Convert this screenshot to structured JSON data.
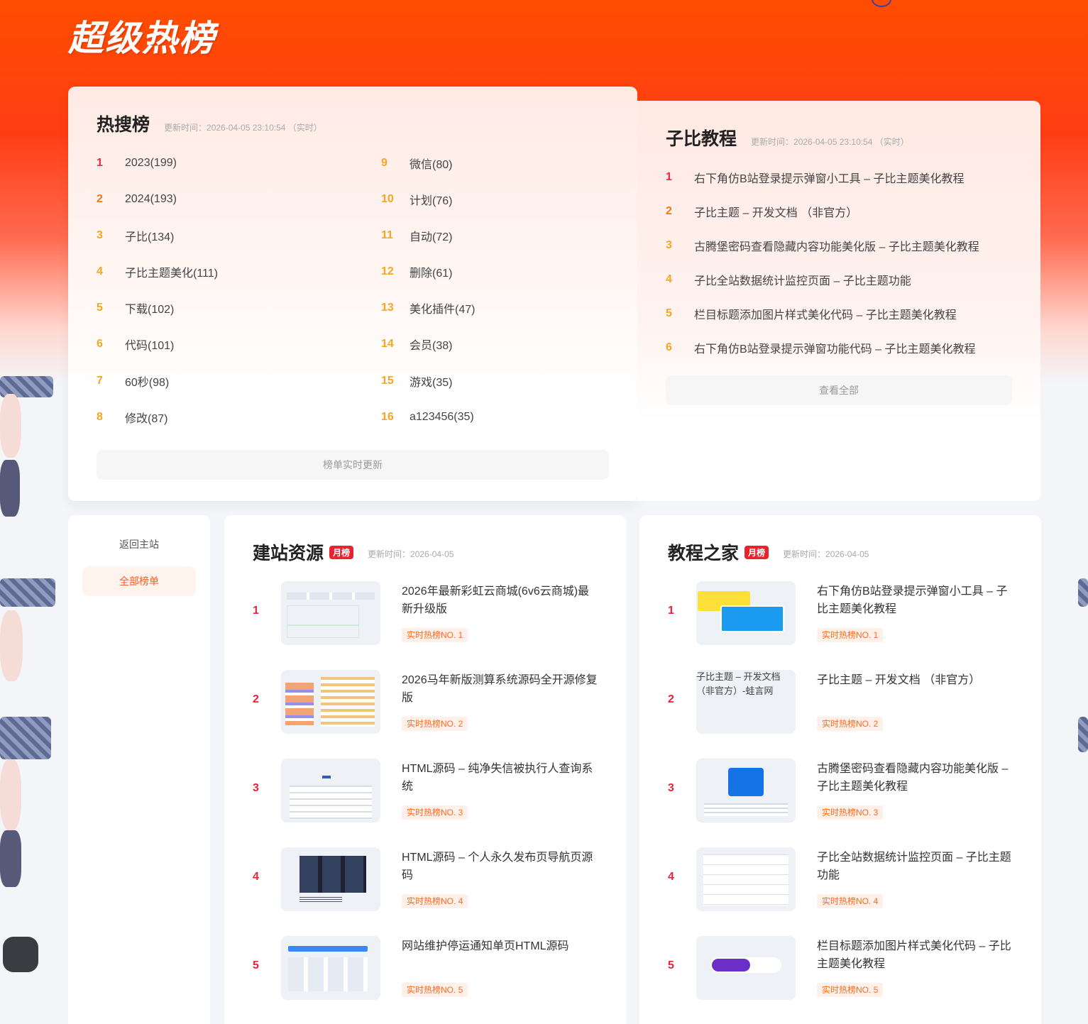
{
  "page": {
    "title": "超级热榜"
  },
  "hot_search": {
    "title": "热搜榜",
    "meta": "更新时间：2026-04-05 23:10:54 （实时）",
    "footer": "榜单实时更新",
    "items": [
      {
        "rank": "1",
        "label": "2023(199)"
      },
      {
        "rank": "2",
        "label": "2024(193)"
      },
      {
        "rank": "3",
        "label": "子比(134)"
      },
      {
        "rank": "4",
        "label": "子比主题美化(111)"
      },
      {
        "rank": "5",
        "label": "下载(102)"
      },
      {
        "rank": "6",
        "label": "代码(101)"
      },
      {
        "rank": "7",
        "label": "60秒(98)"
      },
      {
        "rank": "8",
        "label": "修改(87)"
      },
      {
        "rank": "9",
        "label": "微信(80)"
      },
      {
        "rank": "10",
        "label": "计划(76)"
      },
      {
        "rank": "11",
        "label": "自动(72)"
      },
      {
        "rank": "12",
        "label": "删除(61)"
      },
      {
        "rank": "13",
        "label": "美化插件(47)"
      },
      {
        "rank": "14",
        "label": "会员(38)"
      },
      {
        "rank": "15",
        "label": "游戏(35)"
      },
      {
        "rank": "16",
        "label": "a123456(35)"
      }
    ]
  },
  "zibi_tutorial": {
    "title": "子比教程",
    "meta": "更新时间：2026-04-05 23:10:54 （实时）",
    "footer": "查看全部",
    "items": [
      {
        "rank": "1",
        "label": "右下角仿B站登录提示弹窗小工具 – 子比主题美化教程"
      },
      {
        "rank": "2",
        "label": "子比主题 – 开发文档 （非官方）"
      },
      {
        "rank": "3",
        "label": "古腾堡密码查看隐藏内容功能美化版 – 子比主题美化教程"
      },
      {
        "rank": "4",
        "label": "子比全站数据统计监控页面 – 子比主题功能"
      },
      {
        "rank": "5",
        "label": "栏目标题添加图片样式美化代码 – 子比主题美化教程"
      },
      {
        "rank": "6",
        "label": "右下角仿B站登录提示弹窗功能代码 – 子比主题美化教程"
      }
    ]
  },
  "side_nav": {
    "home": "返回主站",
    "all": "全部榜单"
  },
  "site_resources": {
    "title": "建站资源",
    "tag": "月榜",
    "meta": "更新时间：2026-04-05",
    "items": [
      {
        "rank": "1",
        "title": "2026年最新彩虹云商城(6v6云商城)最新升级版",
        "badge": "实时热榜NO. 1"
      },
      {
        "rank": "2",
        "title": "2026马年新版测算系统源码全开源修复版",
        "badge": "实时热榜NO. 2"
      },
      {
        "rank": "3",
        "title": "HTML源码 – 纯净失信被执行人查询系统",
        "badge": "实时热榜NO. 3"
      },
      {
        "rank": "4",
        "title": "HTML源码 – 个人永久发布页导航页源码",
        "badge": "实时热榜NO. 4"
      },
      {
        "rank": "5",
        "title": "网站维护停运通知单页HTML源码",
        "badge": "实时热榜NO. 5"
      }
    ]
  },
  "tutorial_home": {
    "title": "教程之家",
    "tag": "月榜",
    "meta": "更新时间：2026-04-05",
    "broken_image_alt": "子比主题 – 开发文档 （非官方）-蛙言网",
    "items": [
      {
        "rank": "1",
        "title": "右下角仿B站登录提示弹窗小工具 – 子比主题美化教程",
        "badge": "实时热榜NO. 1"
      },
      {
        "rank": "2",
        "title": "子比主题 – 开发文档 （非官方）",
        "badge": "实时热榜NO. 2"
      },
      {
        "rank": "3",
        "title": "古腾堡密码查看隐藏内容功能美化版 – 子比主题美化教程",
        "badge": "实时热榜NO. 3"
      },
      {
        "rank": "4",
        "title": "子比全站数据统计监控页面 – 子比主题功能",
        "badge": "实时热榜NO. 4"
      },
      {
        "rank": "5",
        "title": "栏目标题添加图片样式美化代码 – 子比主题美化教程",
        "badge": "实时热榜NO. 5"
      }
    ]
  },
  "colors": {
    "hero": "#ff4d00",
    "rank_red": "#ee2846",
    "rank_orange": "#f07a10",
    "rank_yellow": "#f5a623",
    "badge_text": "#ff6a20",
    "tag_bg": "#e8232e"
  }
}
